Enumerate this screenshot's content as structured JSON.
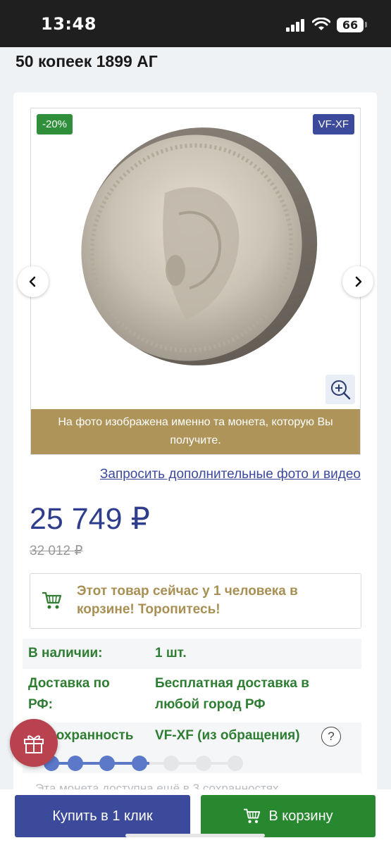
{
  "status_bar": {
    "time": "13:48",
    "battery": "66"
  },
  "page": {
    "title": "50 копеек 1899 АГ"
  },
  "gallery": {
    "discount_badge": "-20%",
    "grade_badge": "VF-XF",
    "caption": "На фото изображена именно та монета, которую Вы получите.",
    "prev_icon": "chevron-left-icon",
    "next_icon": "chevron-right-icon",
    "zoom_icon": "zoom-in-icon"
  },
  "request_link": "Запросить дополнительные фото и видео",
  "pricing": {
    "price": "25 749 ₽",
    "old_price": "32 012 ₽"
  },
  "cart_notice": {
    "text": "Этот товар сейчас у 1 человека в корзине! Торопитесь!",
    "icon": "cart-icon"
  },
  "specs": [
    {
      "key": "В наличии:",
      "value": "1 шт."
    },
    {
      "key": "Доставка по РФ:",
      "value": "Бесплатная доставка в любой город РФ"
    },
    {
      "key": "Сохранность",
      "value": "VF-XF (из обращения)"
    }
  ],
  "grade_scale": {
    "filled": 4,
    "total": 7
  },
  "availability_note": "Эта монета доступна ещё в 3 сохранностях",
  "actions": {
    "buy_one_click": "Купить в 1 клик",
    "add_to_cart": "В корзину"
  },
  "colors": {
    "primary": "#3b4a9a",
    "green": "#27882f",
    "gold": "#ae9459",
    "gift": "#b9424f"
  }
}
